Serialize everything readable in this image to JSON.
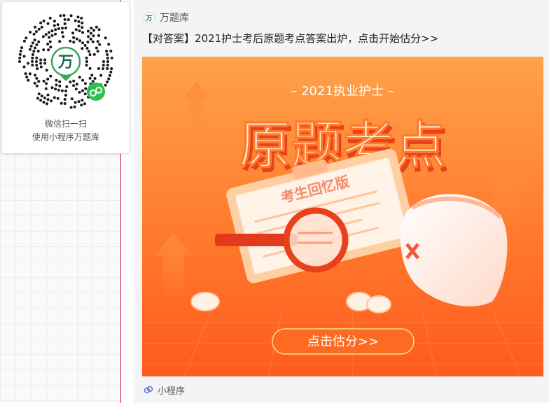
{
  "qr_popup": {
    "caption_line1": "微信扫一扫",
    "caption_line2": "使用小程序万题库",
    "center_logo_char": "万",
    "accent": "#1a6b4a"
  },
  "card": {
    "app_icon_char": "万",
    "app_name": "万题库",
    "title": "【对答案】2021护士考后原题考点答案出炉，点击开始估分>>",
    "banner": {
      "subtitle": "– 2021执业护士 –",
      "headline": "原题考点",
      "stamp": "考生回忆版",
      "cta": "点击估分>>",
      "colors": {
        "bg_top": "#ff9a3c",
        "bg_bottom": "#ff5a1f",
        "headline": "#fff4dc",
        "headline_shadow": "#e8411c"
      }
    },
    "footer_label": "小程序"
  },
  "icons": {
    "app": "wanti-logo-icon",
    "mini_program": "mini-program-link-icon",
    "magnifier": "magnifier-icon",
    "nurse_cap": "nurse-cap-icon",
    "clipboard": "clipboard-icon",
    "pills": "pill-icon"
  }
}
